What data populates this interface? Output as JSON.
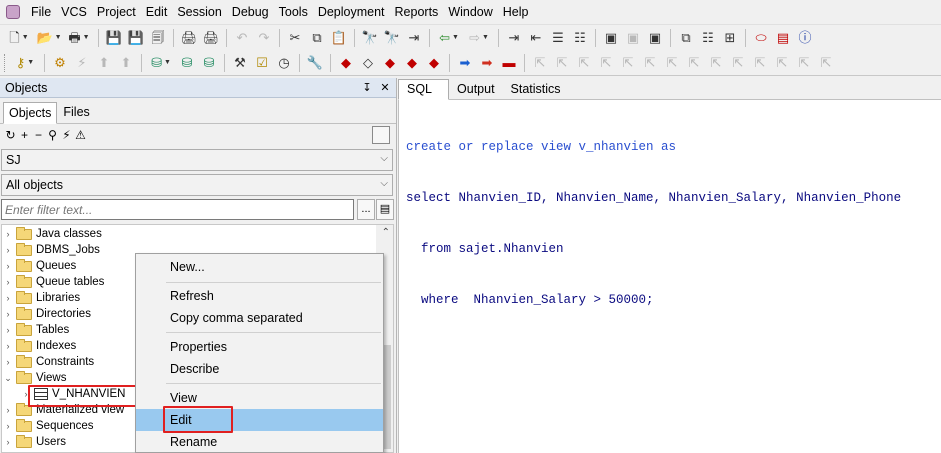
{
  "menubar": {
    "items": [
      "File",
      "VCS",
      "Project",
      "Edit",
      "Session",
      "Debug",
      "Tools",
      "Deployment",
      "Reports",
      "Window",
      "Help"
    ]
  },
  "objects_panel": {
    "title": "Objects",
    "pin_glyph": "↧",
    "close_glyph": "✕",
    "tabs": [
      "Objects",
      "Files"
    ],
    "schema_value": "SJ",
    "filter_value": "All objects",
    "filter_placeholder": "Enter filter text...",
    "filter_more_label": "...",
    "tree": [
      {
        "label": "Java classes",
        "expander": "›"
      },
      {
        "label": "DBMS_Jobs",
        "expander": "›"
      },
      {
        "label": "Queues",
        "expander": "›"
      },
      {
        "label": "Queue tables",
        "expander": "›"
      },
      {
        "label": "Libraries",
        "expander": "›"
      },
      {
        "label": "Directories",
        "expander": "›"
      },
      {
        "label": "Tables",
        "expander": "›"
      },
      {
        "label": "Indexes",
        "expander": "›"
      },
      {
        "label": "Constraints",
        "expander": "›"
      },
      {
        "label": "Views",
        "expander": "⌄"
      },
      {
        "label": "V_NHANVIEN",
        "expander": "›"
      },
      {
        "label": "Materialized view",
        "expander": "›"
      },
      {
        "label": "Sequences",
        "expander": "›"
      },
      {
        "label": "Users",
        "expander": "›"
      }
    ]
  },
  "context_menu": {
    "items": [
      "New...",
      "Refresh",
      "Copy comma separated",
      "Properties",
      "Describe",
      "View",
      "Edit",
      "Rename"
    ],
    "selected": "Edit"
  },
  "editor": {
    "tabs": [
      "SQL",
      "Output",
      "Statistics"
    ],
    "active_tab": "SQL",
    "code_lines": [
      "create or replace view v_nhanvien as",
      "select Nhanvien_ID, Nhanvien_Name, Nhanvien_Salary, Nhanvien_Phone",
      "  from sajet.Nhanvien",
      "  where  Nhanvien_Salary > 50000;"
    ]
  },
  "colors": {
    "highlight_border": "#e02020",
    "menu_selected": "#99c9ef",
    "sql_text": "#0a0a80",
    "panel_title_bg": "#dfe7f2"
  },
  "icons": {
    "toolbar1": [
      "new-file-icon",
      "open-icon",
      "print-icon",
      "save-icon",
      "save-as-icon",
      "save-all-icon",
      "print-setup-icon",
      "page-setup-icon",
      "undo-icon",
      "redo-icon",
      "cut-icon",
      "copy-icon",
      "paste-icon",
      "find-icon",
      "find-replace-icon",
      "goto-icon",
      "forward-icon",
      "new-window-icon",
      "indent-icon",
      "unindent-icon",
      "comment-icon",
      "uncomment-icon",
      "sql-window-icon",
      "command-window-icon",
      "report-window-icon",
      "cascade-icon",
      "tile-icon",
      "grid-icon",
      "oracle-icon",
      "pdf-icon",
      "info-icon"
    ],
    "toolbar2": [
      "key-icon",
      "compile-icon",
      "compile-invalid-icon",
      "export-icon",
      "import-icon",
      "sql-db-icon",
      "db-icon",
      "db-refresh-icon",
      "tools-icon",
      "checklist-icon",
      "schedule-icon",
      "wrench-icon",
      "gem-icon",
      "eraser-icon",
      "ruby-icon",
      "ruby-gear-icon",
      "ruby-edit-icon",
      "arrow-right-blue-icon",
      "arrow-right-red-icon",
      "car-icon"
    ]
  }
}
